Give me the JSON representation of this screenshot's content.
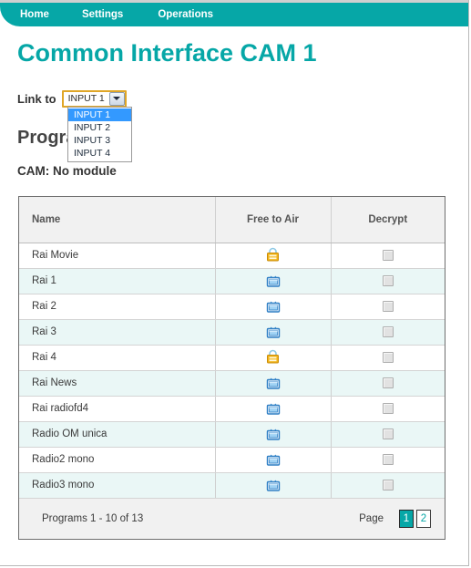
{
  "nav": {
    "items": [
      {
        "label": "Home",
        "active": true
      },
      {
        "label": "Settings",
        "active": false
      },
      {
        "label": "Operations",
        "active": false
      }
    ],
    "bar_color": "#06a7a7"
  },
  "header": {
    "title": "Common Interface CAM 1",
    "title_color": "#06a7a7"
  },
  "link_to": {
    "label": "Link to",
    "selected": "INPUT 1",
    "options": [
      "INPUT 1",
      "INPUT 2",
      "INPUT 3",
      "INPUT 4"
    ],
    "dropdown_open": true,
    "highlight_color": "#3399ff",
    "focus_border_color": "#e0a626"
  },
  "program_list": {
    "section_title": "Program List",
    "cam_status": "CAM: No module",
    "columns": [
      "Name",
      "Free to Air",
      "Decrypt"
    ],
    "rows": [
      {
        "name": "Rai Movie",
        "free_to_air_icon": "padlock-icon",
        "decrypt_checked": false
      },
      {
        "name": "Rai 1",
        "free_to_air_icon": "tv-icon",
        "decrypt_checked": false
      },
      {
        "name": "Rai 2",
        "free_to_air_icon": "tv-icon",
        "decrypt_checked": false
      },
      {
        "name": "Rai 3",
        "free_to_air_icon": "tv-icon",
        "decrypt_checked": false
      },
      {
        "name": "Rai 4",
        "free_to_air_icon": "padlock-icon",
        "decrypt_checked": false
      },
      {
        "name": "Rai News",
        "free_to_air_icon": "tv-icon",
        "decrypt_checked": false
      },
      {
        "name": "Rai radiofd4",
        "free_to_air_icon": "tv-icon",
        "decrypt_checked": false
      },
      {
        "name": "Radio OM unica",
        "free_to_air_icon": "tv-icon",
        "decrypt_checked": false
      },
      {
        "name": "Radio2 mono",
        "free_to_air_icon": "tv-icon",
        "decrypt_checked": false
      },
      {
        "name": "Radio3 mono",
        "free_to_air_icon": "tv-icon",
        "decrypt_checked": false
      }
    ],
    "footer": {
      "count_text": "Programs 1 - 10 of 13",
      "page_label": "Page",
      "pages": [
        {
          "label": "1",
          "active": true
        },
        {
          "label": "2",
          "active": false
        }
      ]
    }
  }
}
